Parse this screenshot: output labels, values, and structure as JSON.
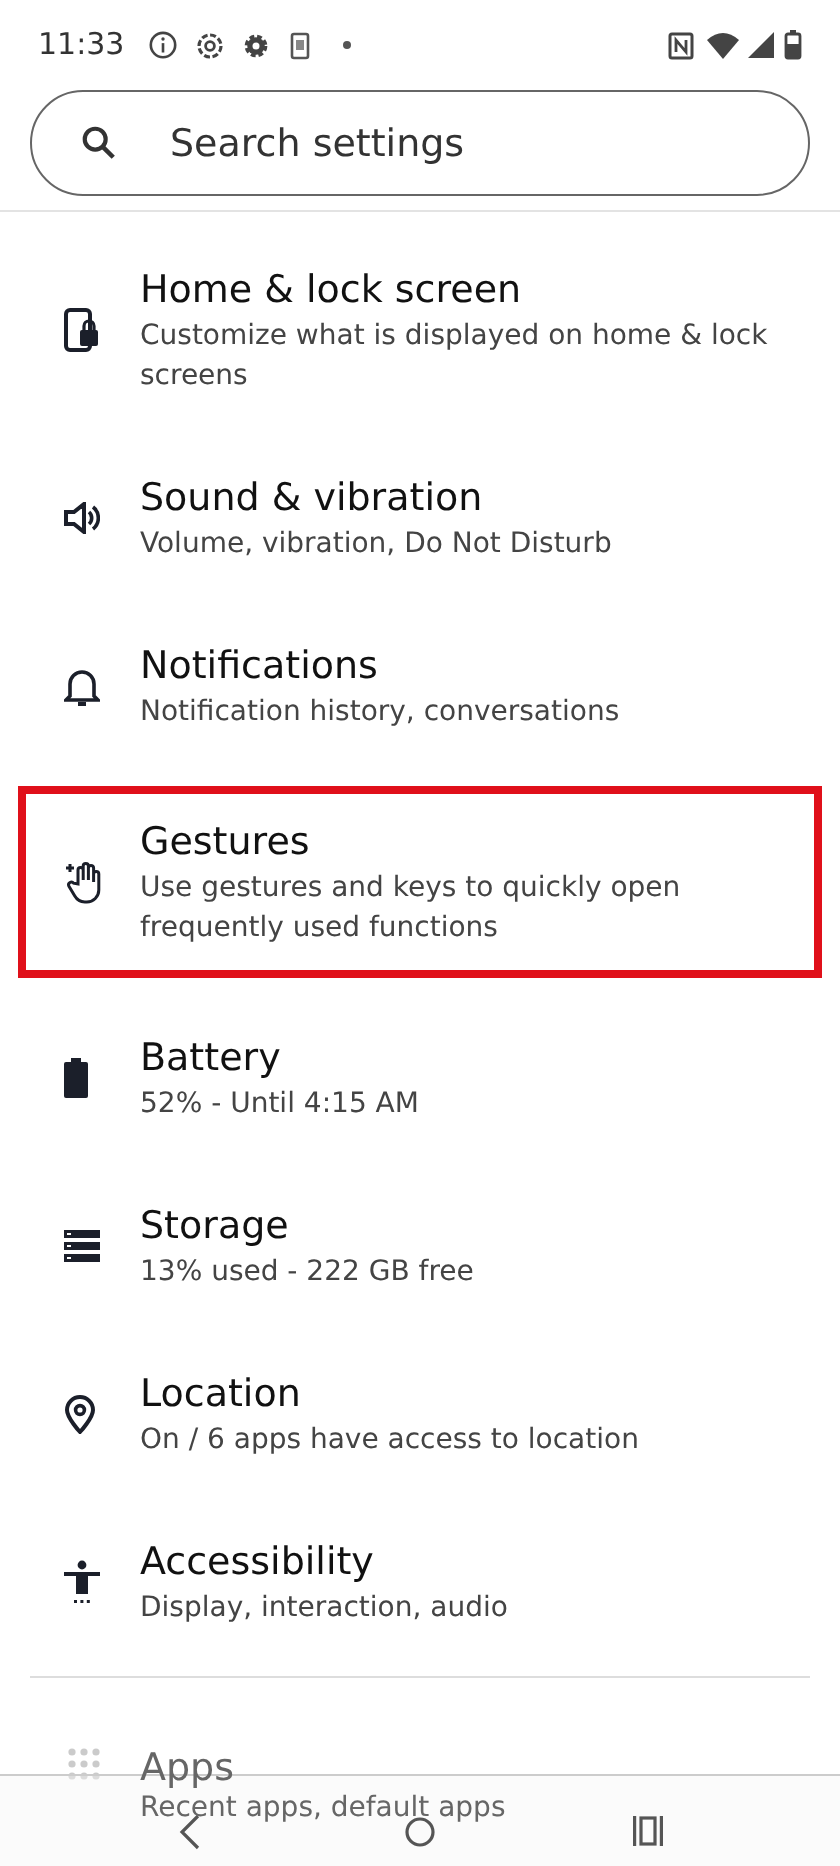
{
  "status_bar": {
    "time": "11:33"
  },
  "search": {
    "placeholder": "Search settings"
  },
  "items": [
    {
      "title": "Home & lock screen",
      "subtitle": "Customize what is displayed on home & lock screens",
      "highlighted": false
    },
    {
      "title": "Sound & vibration",
      "subtitle": "Volume, vibration, Do Not Disturb",
      "highlighted": false
    },
    {
      "title": "Notifications",
      "subtitle": "Notification history, conversations",
      "highlighted": false
    },
    {
      "title": "Gestures",
      "subtitle": "Use gestures and keys to quickly open frequently used functions",
      "highlighted": true
    },
    {
      "title": "Battery",
      "subtitle": "52% - Until 4:15 AM",
      "highlighted": false
    },
    {
      "title": "Storage",
      "subtitle": "13% used - 222 GB free",
      "highlighted": false
    },
    {
      "title": "Location",
      "subtitle": "On / 6 apps have access to location",
      "highlighted": false
    },
    {
      "title": "Accessibility",
      "subtitle": "Display, interaction, audio",
      "highlighted": false
    }
  ],
  "partial_item": {
    "title": "Apps",
    "subtitle": "Recent apps, default apps"
  }
}
